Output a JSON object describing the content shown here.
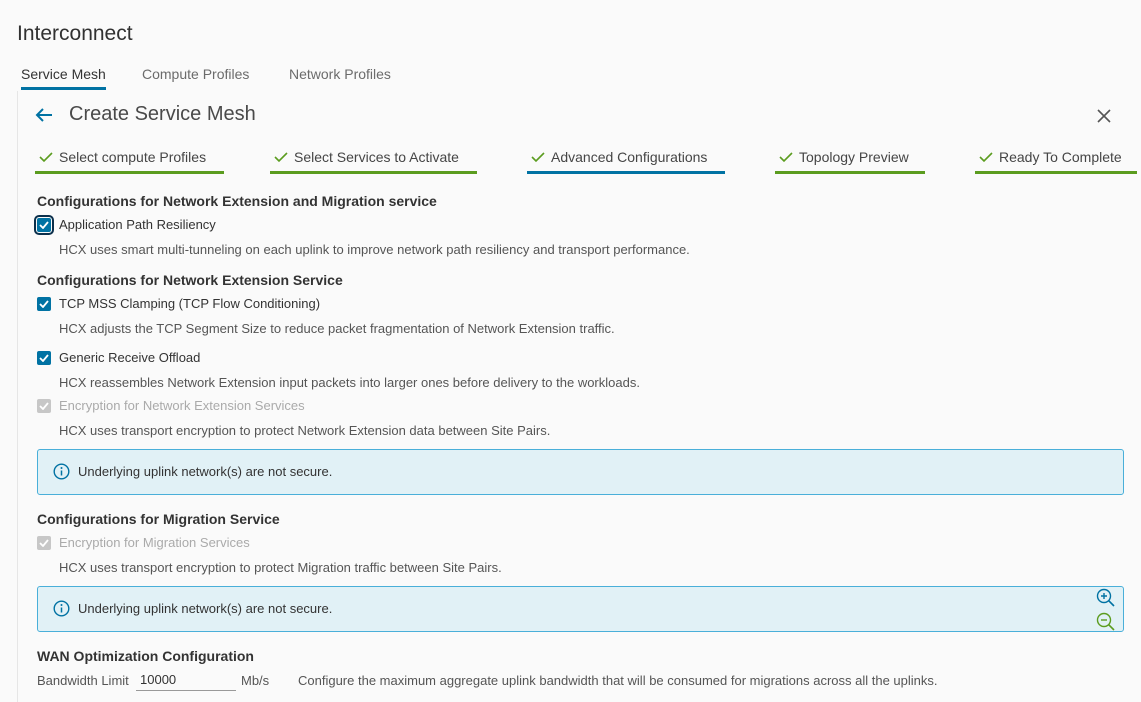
{
  "app": {
    "title": "Interconnect"
  },
  "top_tabs": [
    {
      "label": "Service Mesh",
      "active": true
    },
    {
      "label": "Compute Profiles",
      "active": false
    },
    {
      "label": "Network Profiles",
      "active": false
    }
  ],
  "wizard": {
    "title": "Create Service Mesh",
    "steps": [
      {
        "label": "Select compute Profiles",
        "state": "completed"
      },
      {
        "label": "Select Services to Activate",
        "state": "completed"
      },
      {
        "label": "Advanced Configurations",
        "state": "current"
      },
      {
        "label": "Topology Preview",
        "state": "completed"
      },
      {
        "label": "Ready To Complete",
        "state": "completed"
      }
    ]
  },
  "sections": {
    "ne_migration": {
      "heading": "Configurations for Network Extension and Migration service",
      "app_path": {
        "label": "Application Path Resiliency",
        "checked": true,
        "description": "HCX uses smart multi-tunneling on each uplink to improve network path resiliency and transport performance."
      }
    },
    "ne": {
      "heading": "Configurations for Network Extension Service",
      "tcp_mss": {
        "label": "TCP MSS Clamping (TCP Flow Conditioning)",
        "checked": true,
        "description": "HCX adjusts the TCP Segment Size to reduce packet fragmentation of Network Extension traffic."
      },
      "gro": {
        "label": "Generic Receive Offload",
        "checked": true,
        "description": "HCX reassembles Network Extension input packets into larger ones before delivery to the workloads."
      },
      "encryption": {
        "label": "Encryption for Network Extension Services",
        "checked": true,
        "disabled": true,
        "description": "HCX uses transport encryption to protect Network Extension data between Site Pairs."
      },
      "alert": "Underlying uplink network(s) are not secure."
    },
    "migration": {
      "heading": "Configurations for Migration Service",
      "encryption": {
        "label": "Encryption for Migration Services",
        "checked": true,
        "disabled": true,
        "description": "HCX uses transport encryption to protect Migration traffic between Site Pairs."
      },
      "alert": "Underlying uplink network(s) are not secure."
    },
    "wan": {
      "heading": "WAN Optimization Configuration",
      "bandwidth_label": "Bandwidth Limit",
      "bandwidth_value": "10000",
      "unit": "Mb/s",
      "description": "Configure the maximum aggregate uplink bandwidth that will be consumed for migrations across all the uplinks."
    }
  },
  "colors": {
    "accent": "#0072a3",
    "step_complete": "#5b9c1f",
    "alert_bg": "#e1f1f6",
    "alert_border": "#49afd9",
    "zoom_in": "#0072a3",
    "zoom_out": "#5b9c1f"
  },
  "icons": {
    "back": "arrow-left-icon",
    "close": "close-icon",
    "step_check": "check-icon",
    "info": "info-icon",
    "zoom_in": "zoom-in-icon",
    "zoom_out": "zoom-out-icon"
  }
}
